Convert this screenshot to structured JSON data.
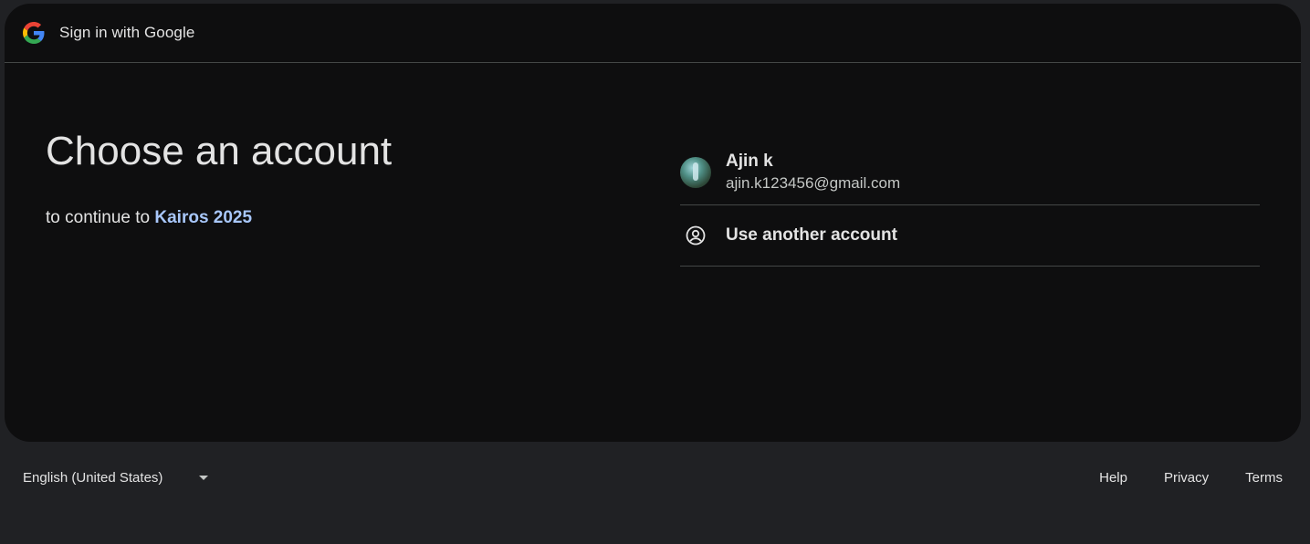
{
  "header": {
    "title": "Sign in with Google"
  },
  "main": {
    "headline": "Choose an account",
    "continue_prefix": "to continue to",
    "app_name": "Kairos 2025"
  },
  "accounts": [
    {
      "name": "Ajin k",
      "email": "ajin.k123456@gmail.com"
    }
  ],
  "another_account_label": "Use another account",
  "footer": {
    "language": "English (United States)",
    "links": [
      "Help",
      "Privacy",
      "Terms"
    ]
  },
  "colors": {
    "link_accent": "#a8c7fa",
    "card_bg": "#0e0e0f",
    "page_bg": "#202124"
  },
  "icons": {
    "logo": "google-g-icon",
    "another_account": "account-circle-icon",
    "language_dropdown": "caret-down-icon"
  }
}
